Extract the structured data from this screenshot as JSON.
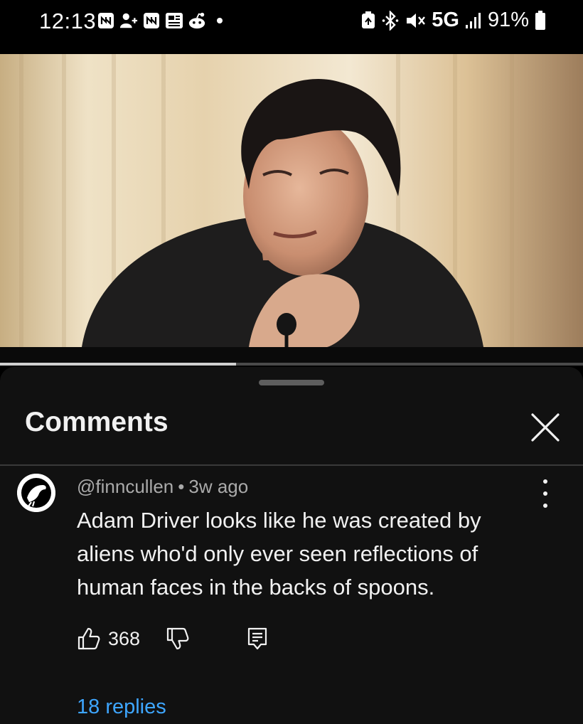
{
  "status_bar": {
    "time": "12:13",
    "notification_icons": [
      "nfc-icon",
      "person-add-icon",
      "nfc-icon",
      "news-icon",
      "reddit-icon",
      "dot-icon"
    ],
    "network": "5G",
    "battery": "91%"
  },
  "video": {
    "description_icon": "video-frame",
    "progress_fraction": 0.405
  },
  "comments_panel": {
    "title": "Comments"
  },
  "comment": {
    "author": "@finncullen",
    "separator": "•",
    "age": "3w ago",
    "text": "Adam Driver looks like he was created by aliens who'd only ever seen reflections of human faces in the backs of spoons.",
    "likes": "368",
    "replies_label": "18 replies"
  },
  "colors": {
    "background": "#111111",
    "link_blue": "#3ea6ff",
    "secondary_text": "#aaaaaa"
  }
}
